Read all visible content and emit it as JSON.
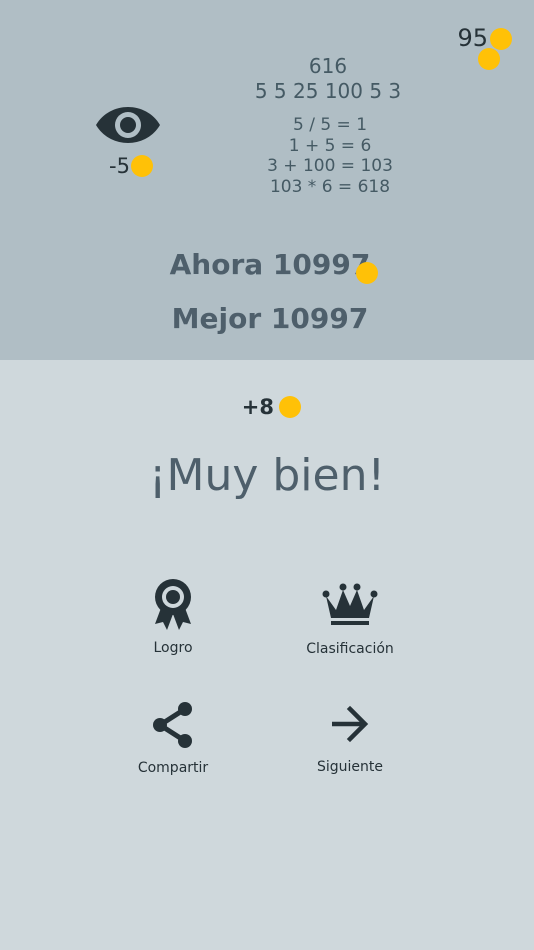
{
  "header": {
    "coins": "95",
    "hint_cost": "-5"
  },
  "puzzle": {
    "target": "616",
    "numbers": "5 5 25 100 5 3",
    "steps": [
      "5 / 5 = 1",
      "1 + 5 = 6",
      "3 + 100 = 103",
      "103 * 6 = 618"
    ]
  },
  "scores": {
    "current": "Ahora 10997",
    "best": "Mejor 10997"
  },
  "result": {
    "reward": "+8",
    "message": "¡Muy bien!"
  },
  "actions": {
    "achievement": "Logro",
    "leaderboard": "Clasificación",
    "share": "Compartir",
    "next": "Siguiente"
  },
  "colors": {
    "top_panel": "#b0bec5",
    "bottom_panel": "#cfd8dc",
    "coin": "#ffc107",
    "icon": "#263238"
  },
  "icons": [
    "coin-icon",
    "eye-icon",
    "award-icon",
    "crown-icon",
    "share-icon",
    "arrow-right-icon"
  ]
}
